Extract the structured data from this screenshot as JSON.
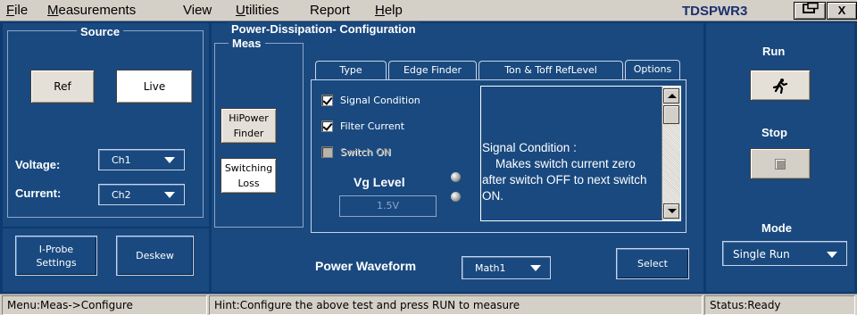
{
  "menu": {
    "items": [
      {
        "key": "F",
        "rest": "ile"
      },
      {
        "key": "M",
        "rest": "easurements"
      },
      {
        "key": "",
        "rest": "View"
      },
      {
        "key": "U",
        "rest": "tilities"
      },
      {
        "key": "",
        "rest": "Report"
      },
      {
        "key": "H",
        "rest": "elp"
      }
    ],
    "app_title": "TDSPWR3",
    "close_label": "X"
  },
  "source": {
    "title": "Source",
    "ref_label": "Ref",
    "live_label": "Live",
    "voltage_label": "Voltage:",
    "voltage_value": "Ch1",
    "current_label": "Current:",
    "current_value": "Ch2",
    "iprobe_label": "I-Probe Settings",
    "deskew_label": "Deskew"
  },
  "config": {
    "title": "Power-Dissipation- Configuration",
    "meas_title": "Meas",
    "hipower_label": "HiPower Finder",
    "switching_label": "Switching Loss",
    "tabs": [
      "Type",
      "Edge Finder",
      "Ton & Toff RefLevel",
      "Options"
    ],
    "active_tab": "Options",
    "signal_condition_label": "Signal Condition",
    "filter_current_label": "Filter Current",
    "switch_on_label": "Switch ON",
    "vg_level_label": "Vg Level",
    "vg_level_value": "1.5V",
    "description": "Signal Condition :\n    Makes switch current zero after switch OFF to next switch ON.",
    "power_waveform_label": "Power Waveform",
    "power_waveform_value": "Math1",
    "select_label": "Select"
  },
  "run": {
    "run_title": "Run",
    "stop_title": "Stop",
    "mode_title": "Mode",
    "mode_value": "Single Run"
  },
  "status": {
    "menu_path": "Menu:Meas->Configure",
    "hint": "Hint:Configure the above test and press RUN to measure",
    "state": "Status:Ready"
  }
}
